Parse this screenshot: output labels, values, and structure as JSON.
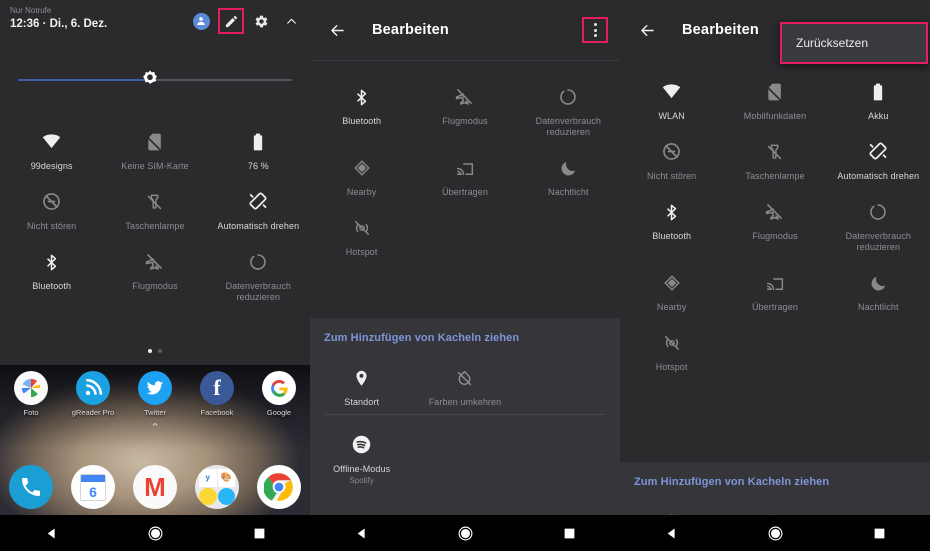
{
  "accent": {
    "highlight": "#e31d62",
    "link_blue": "#7e96d8",
    "slider_blue": "#3c5fa6"
  },
  "left_panel": {
    "status": {
      "carrier": "Nur Notrufe",
      "clock": "12:36 · Di., 6. Dez."
    },
    "header_icons": [
      {
        "name": "account-avatar",
        "glyph": "account"
      },
      {
        "name": "edit-pencil",
        "glyph": "pencil",
        "highlighted": true
      },
      {
        "name": "settings-gear",
        "glyph": "gear"
      },
      {
        "name": "collapse-chevron",
        "glyph": "chevron-up"
      }
    ],
    "brightness": {
      "name": "brightness-slider",
      "value_pct": 48
    },
    "tiles": [
      {
        "label": "99designs",
        "icon": "wifi",
        "on": true
      },
      {
        "label": "Keine SIM-Karte",
        "icon": "sim-off",
        "on": false
      },
      {
        "label": "76 %",
        "icon": "battery",
        "on": true
      },
      {
        "label": "Nicht stören",
        "icon": "dnd",
        "on": false
      },
      {
        "label": "Taschenlampe",
        "icon": "flashlight",
        "on": false
      },
      {
        "label": "Automatisch drehen",
        "icon": "auto-rotate",
        "on": true
      },
      {
        "label": "Bluetooth",
        "icon": "bluetooth",
        "on": true
      },
      {
        "label": "Flugmodus",
        "icon": "airplane",
        "on": false
      },
      {
        "label": "Datenverbrauch reduzieren",
        "icon": "data-saver",
        "on": false
      }
    ],
    "page_dots": {
      "count": 2,
      "active": 0
    },
    "home_apps": [
      {
        "label": "Foto",
        "icon": "photos"
      },
      {
        "label": "gReader Pro",
        "icon": "rss"
      },
      {
        "label": "Twitter",
        "icon": "twitter"
      },
      {
        "label": "Facebook",
        "icon": "facebook"
      },
      {
        "label": "Google",
        "icon": "google"
      }
    ],
    "dock_apps": [
      {
        "name": "phone",
        "icon": "phone"
      },
      {
        "name": "calendar",
        "icon": "calendar-6"
      },
      {
        "name": "gmail",
        "icon": "gmail"
      },
      {
        "name": "folder",
        "icon": "folder"
      },
      {
        "name": "chrome",
        "icon": "chrome"
      }
    ]
  },
  "middle_panel": {
    "title": "Bearbeiten",
    "back": "back-arrow",
    "overflow": {
      "name": "overflow-menu",
      "highlighted": true
    },
    "tiles": [
      {
        "label": "Bluetooth",
        "icon": "bluetooth",
        "on": true
      },
      {
        "label": "Flugmodus",
        "icon": "airplane",
        "on": false
      },
      {
        "label": "Datenverbrauch reduzieren",
        "icon": "data-saver",
        "on": false
      },
      {
        "label": "Nearby",
        "icon": "nearby",
        "on": false
      },
      {
        "label": "Übertragen",
        "icon": "cast",
        "on": false
      },
      {
        "label": "Nachtlicht",
        "icon": "night-light",
        "on": false
      },
      {
        "label": "Hotspot",
        "icon": "hotspot",
        "on": false
      }
    ],
    "drag_title": "Zum Hinzufügen von Kacheln ziehen",
    "drag_tiles": [
      {
        "label": "Standort",
        "icon": "location",
        "on": true
      },
      {
        "label": "Farben umkehren",
        "icon": "invert-colors",
        "on": false
      }
    ],
    "drag_tiles_2": [
      {
        "label": "Offline-Modus",
        "sub": "Spotify",
        "icon": "spotify",
        "on": true
      }
    ]
  },
  "right_panel": {
    "title": "Bearbeiten",
    "back": "back-arrow",
    "menu_item": "Zurücksetzen",
    "tiles": [
      {
        "label": "WLAN",
        "icon": "wifi",
        "on": true
      },
      {
        "label": "Mobilfunkdaten",
        "icon": "sim-off",
        "on": false
      },
      {
        "label": "Akku",
        "icon": "battery",
        "on": true
      },
      {
        "label": "Nicht stören",
        "icon": "dnd",
        "on": false
      },
      {
        "label": "Taschenlampe",
        "icon": "flashlight",
        "on": false
      },
      {
        "label": "Automatisch drehen",
        "icon": "auto-rotate",
        "on": true
      },
      {
        "label": "Bluetooth",
        "icon": "bluetooth",
        "on": true
      },
      {
        "label": "Flugmodus",
        "icon": "airplane",
        "on": false
      },
      {
        "label": "Datenverbrauch reduzieren",
        "icon": "data-saver",
        "on": false
      },
      {
        "label": "Nearby",
        "icon": "nearby",
        "on": false
      },
      {
        "label": "Übertragen",
        "icon": "cast",
        "on": false
      },
      {
        "label": "Nachtlicht",
        "icon": "night-light",
        "on": false
      },
      {
        "label": "Hotspot",
        "icon": "hotspot",
        "on": false
      }
    ],
    "drag_title": "Zum Hinzufügen von Kacheln ziehen"
  },
  "navbar": {
    "back": "nav-back",
    "home": "nav-home",
    "recents": "nav-recents"
  }
}
